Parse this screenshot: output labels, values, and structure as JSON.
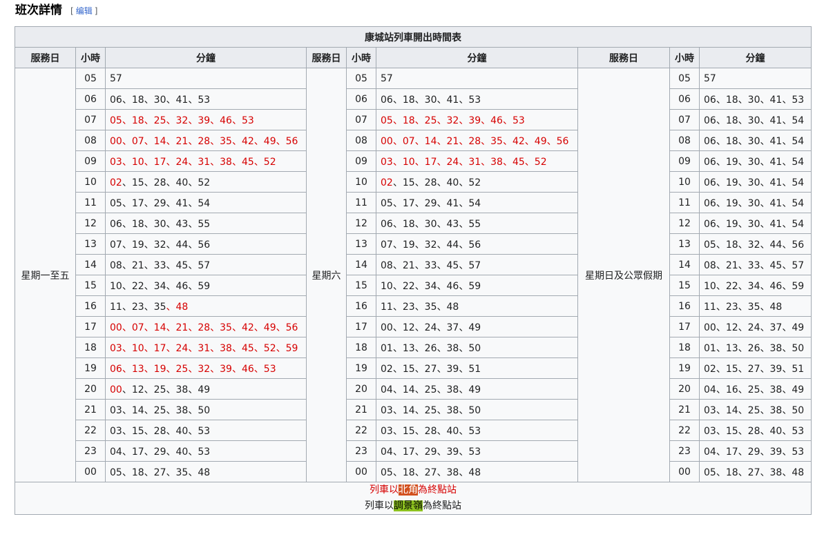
{
  "section": {
    "title": "班次詳情",
    "edit": "编辑",
    "bl": "[",
    "br": "]"
  },
  "table": {
    "caption": "康城站列車開出時間表",
    "headers": {
      "day": "服務日",
      "hour": "小時",
      "min": "分鐘"
    },
    "days": [
      "星期一至五",
      "星期六",
      "星期日及公眾假期"
    ],
    "hours": [
      "05",
      "06",
      "07",
      "08",
      "09",
      "10",
      "11",
      "12",
      "13",
      "14",
      "15",
      "16",
      "17",
      "18",
      "19",
      "20",
      "21",
      "22",
      "23",
      "00"
    ],
    "sep": "、",
    "weekday": [
      [
        {
          "v": "57"
        }
      ],
      [
        {
          "v": "06"
        },
        {
          "v": "18"
        },
        {
          "v": "30"
        },
        {
          "v": "41"
        },
        {
          "v": "53"
        }
      ],
      [
        {
          "v": "05",
          "r": 1
        },
        {
          "v": "18",
          "r": 1
        },
        {
          "v": "25",
          "r": 1
        },
        {
          "v": "32",
          "r": 1
        },
        {
          "v": "39",
          "r": 1
        },
        {
          "v": "46",
          "r": 1
        },
        {
          "v": "53",
          "r": 1
        }
      ],
      [
        {
          "v": "00",
          "r": 1
        },
        {
          "v": "07",
          "r": 1
        },
        {
          "v": "14",
          "r": 1
        },
        {
          "v": "21",
          "r": 1
        },
        {
          "v": "28",
          "r": 1
        },
        {
          "v": "35",
          "r": 1
        },
        {
          "v": "42",
          "r": 1
        },
        {
          "v": "49",
          "r": 1
        },
        {
          "v": "56",
          "r": 1
        }
      ],
      [
        {
          "v": "03",
          "r": 1
        },
        {
          "v": "10",
          "r": 1
        },
        {
          "v": "17",
          "r": 1
        },
        {
          "v": "24",
          "r": 1
        },
        {
          "v": "31",
          "r": 1
        },
        {
          "v": "38",
          "r": 1
        },
        {
          "v": "45",
          "r": 1
        },
        {
          "v": "52",
          "r": 1
        }
      ],
      [
        {
          "v": "02",
          "r": 1
        },
        {
          "v": "15"
        },
        {
          "v": "28"
        },
        {
          "v": "40"
        },
        {
          "v": "52"
        }
      ],
      [
        {
          "v": "05"
        },
        {
          "v": "17"
        },
        {
          "v": "29"
        },
        {
          "v": "41"
        },
        {
          "v": "54"
        }
      ],
      [
        {
          "v": "06"
        },
        {
          "v": "18"
        },
        {
          "v": "30"
        },
        {
          "v": "43"
        },
        {
          "v": "55"
        }
      ],
      [
        {
          "v": "07"
        },
        {
          "v": "19"
        },
        {
          "v": "32"
        },
        {
          "v": "44"
        },
        {
          "v": "56"
        }
      ],
      [
        {
          "v": "08"
        },
        {
          "v": "21"
        },
        {
          "v": "33"
        },
        {
          "v": "45"
        },
        {
          "v": "57"
        }
      ],
      [
        {
          "v": "10"
        },
        {
          "v": "22"
        },
        {
          "v": "34"
        },
        {
          "v": "46"
        },
        {
          "v": "59"
        }
      ],
      [
        {
          "v": "11"
        },
        {
          "v": "23"
        },
        {
          "v": "35"
        },
        {
          "v": "48",
          "r": 1
        }
      ],
      [
        {
          "v": "00",
          "r": 1
        },
        {
          "v": "07",
          "r": 1
        },
        {
          "v": "14",
          "r": 1
        },
        {
          "v": "21",
          "r": 1
        },
        {
          "v": "28",
          "r": 1
        },
        {
          "v": "35",
          "r": 1
        },
        {
          "v": "42",
          "r": 1
        },
        {
          "v": "49",
          "r": 1
        },
        {
          "v": "56",
          "r": 1
        }
      ],
      [
        {
          "v": "03",
          "r": 1
        },
        {
          "v": "10",
          "r": 1
        },
        {
          "v": "17",
          "r": 1
        },
        {
          "v": "24",
          "r": 1
        },
        {
          "v": "31",
          "r": 1
        },
        {
          "v": "38",
          "r": 1
        },
        {
          "v": "45",
          "r": 1
        },
        {
          "v": "52",
          "r": 1
        },
        {
          "v": "59",
          "r": 1
        }
      ],
      [
        {
          "v": "06",
          "r": 1
        },
        {
          "v": "13",
          "r": 1
        },
        {
          "v": "19",
          "r": 1
        },
        {
          "v": "25",
          "r": 1
        },
        {
          "v": "32",
          "r": 1
        },
        {
          "v": "39",
          "r": 1
        },
        {
          "v": "46",
          "r": 1
        },
        {
          "v": "53",
          "r": 1
        }
      ],
      [
        {
          "v": "00",
          "r": 1
        },
        {
          "v": "12"
        },
        {
          "v": "25"
        },
        {
          "v": "38"
        },
        {
          "v": "49"
        }
      ],
      [
        {
          "v": "03"
        },
        {
          "v": "14"
        },
        {
          "v": "25"
        },
        {
          "v": "38"
        },
        {
          "v": "50"
        }
      ],
      [
        {
          "v": "03"
        },
        {
          "v": "15"
        },
        {
          "v": "28"
        },
        {
          "v": "40"
        },
        {
          "v": "53"
        }
      ],
      [
        {
          "v": "04"
        },
        {
          "v": "17"
        },
        {
          "v": "29"
        },
        {
          "v": "40"
        },
        {
          "v": "53"
        }
      ],
      [
        {
          "v": "05"
        },
        {
          "v": "18"
        },
        {
          "v": "27"
        },
        {
          "v": "35"
        },
        {
          "v": "48"
        }
      ]
    ],
    "saturday": [
      [
        {
          "v": "57"
        }
      ],
      [
        {
          "v": "06"
        },
        {
          "v": "18"
        },
        {
          "v": "30"
        },
        {
          "v": "41"
        },
        {
          "v": "53"
        }
      ],
      [
        {
          "v": "05",
          "r": 1
        },
        {
          "v": "18",
          "r": 1
        },
        {
          "v": "25",
          "r": 1
        },
        {
          "v": "32",
          "r": 1
        },
        {
          "v": "39",
          "r": 1
        },
        {
          "v": "46",
          "r": 1
        },
        {
          "v": "53",
          "r": 1
        }
      ],
      [
        {
          "v": "00",
          "r": 1
        },
        {
          "v": "07",
          "r": 1
        },
        {
          "v": "14",
          "r": 1
        },
        {
          "v": "21",
          "r": 1
        },
        {
          "v": "28",
          "r": 1
        },
        {
          "v": "35",
          "r": 1
        },
        {
          "v": "42",
          "r": 1
        },
        {
          "v": "49",
          "r": 1
        },
        {
          "v": "56",
          "r": 1
        }
      ],
      [
        {
          "v": "03",
          "r": 1
        },
        {
          "v": "10",
          "r": 1
        },
        {
          "v": "17",
          "r": 1
        },
        {
          "v": "24",
          "r": 1
        },
        {
          "v": "31",
          "r": 1
        },
        {
          "v": "38",
          "r": 1
        },
        {
          "v": "45",
          "r": 1
        },
        {
          "v": "52",
          "r": 1
        }
      ],
      [
        {
          "v": "02",
          "r": 1
        },
        {
          "v": "15"
        },
        {
          "v": "28"
        },
        {
          "v": "40"
        },
        {
          "v": "52"
        }
      ],
      [
        {
          "v": "05"
        },
        {
          "v": "17"
        },
        {
          "v": "29"
        },
        {
          "v": "41"
        },
        {
          "v": "54"
        }
      ],
      [
        {
          "v": "06"
        },
        {
          "v": "18"
        },
        {
          "v": "30"
        },
        {
          "v": "43"
        },
        {
          "v": "55"
        }
      ],
      [
        {
          "v": "07"
        },
        {
          "v": "19"
        },
        {
          "v": "32"
        },
        {
          "v": "44"
        },
        {
          "v": "56"
        }
      ],
      [
        {
          "v": "08"
        },
        {
          "v": "21"
        },
        {
          "v": "33"
        },
        {
          "v": "45"
        },
        {
          "v": "57"
        }
      ],
      [
        {
          "v": "10"
        },
        {
          "v": "22"
        },
        {
          "v": "34"
        },
        {
          "v": "46"
        },
        {
          "v": "59"
        }
      ],
      [
        {
          "v": "11"
        },
        {
          "v": "23"
        },
        {
          "v": "35"
        },
        {
          "v": "48"
        }
      ],
      [
        {
          "v": "00"
        },
        {
          "v": "12"
        },
        {
          "v": "24"
        },
        {
          "v": "37"
        },
        {
          "v": "49"
        }
      ],
      [
        {
          "v": "01"
        },
        {
          "v": "13"
        },
        {
          "v": "26"
        },
        {
          "v": "38"
        },
        {
          "v": "50"
        }
      ],
      [
        {
          "v": "02"
        },
        {
          "v": "15"
        },
        {
          "v": "27"
        },
        {
          "v": "39"
        },
        {
          "v": "51"
        }
      ],
      [
        {
          "v": "04"
        },
        {
          "v": "14"
        },
        {
          "v": "25"
        },
        {
          "v": "38"
        },
        {
          "v": "49"
        }
      ],
      [
        {
          "v": "03"
        },
        {
          "v": "14"
        },
        {
          "v": "25"
        },
        {
          "v": "38"
        },
        {
          "v": "50"
        }
      ],
      [
        {
          "v": "03"
        },
        {
          "v": "15"
        },
        {
          "v": "28"
        },
        {
          "v": "40"
        },
        {
          "v": "53"
        }
      ],
      [
        {
          "v": "04"
        },
        {
          "v": "17"
        },
        {
          "v": "29"
        },
        {
          "v": "39"
        },
        {
          "v": "53"
        }
      ],
      [
        {
          "v": "05"
        },
        {
          "v": "18"
        },
        {
          "v": "27"
        },
        {
          "v": "38"
        },
        {
          "v": "48"
        }
      ]
    ],
    "sunday": [
      [
        {
          "v": "57"
        }
      ],
      [
        {
          "v": "06"
        },
        {
          "v": "18"
        },
        {
          "v": "30"
        },
        {
          "v": "41"
        },
        {
          "v": "53"
        }
      ],
      [
        {
          "v": "06"
        },
        {
          "v": "18"
        },
        {
          "v": "30"
        },
        {
          "v": "41"
        },
        {
          "v": "54"
        }
      ],
      [
        {
          "v": "06"
        },
        {
          "v": "18"
        },
        {
          "v": "30"
        },
        {
          "v": "41"
        },
        {
          "v": "54"
        }
      ],
      [
        {
          "v": "06"
        },
        {
          "v": "19"
        },
        {
          "v": "30"
        },
        {
          "v": "41"
        },
        {
          "v": "54"
        }
      ],
      [
        {
          "v": "06"
        },
        {
          "v": "19"
        },
        {
          "v": "30"
        },
        {
          "v": "41"
        },
        {
          "v": "54"
        }
      ],
      [
        {
          "v": "06"
        },
        {
          "v": "19"
        },
        {
          "v": "30"
        },
        {
          "v": "41"
        },
        {
          "v": "54"
        }
      ],
      [
        {
          "v": "06"
        },
        {
          "v": "19"
        },
        {
          "v": "30"
        },
        {
          "v": "41"
        },
        {
          "v": "54"
        }
      ],
      [
        {
          "v": "05"
        },
        {
          "v": "18"
        },
        {
          "v": "32"
        },
        {
          "v": "44"
        },
        {
          "v": "56"
        }
      ],
      [
        {
          "v": "08"
        },
        {
          "v": "21"
        },
        {
          "v": "33"
        },
        {
          "v": "45"
        },
        {
          "v": "57"
        }
      ],
      [
        {
          "v": "10"
        },
        {
          "v": "22"
        },
        {
          "v": "34"
        },
        {
          "v": "46"
        },
        {
          "v": "59"
        }
      ],
      [
        {
          "v": "11"
        },
        {
          "v": "23"
        },
        {
          "v": "35"
        },
        {
          "v": "48"
        }
      ],
      [
        {
          "v": "00"
        },
        {
          "v": "12"
        },
        {
          "v": "24"
        },
        {
          "v": "37"
        },
        {
          "v": "49"
        }
      ],
      [
        {
          "v": "01"
        },
        {
          "v": "13"
        },
        {
          "v": "26"
        },
        {
          "v": "38"
        },
        {
          "v": "50"
        }
      ],
      [
        {
          "v": "02"
        },
        {
          "v": "15"
        },
        {
          "v": "27"
        },
        {
          "v": "39"
        },
        {
          "v": "51"
        }
      ],
      [
        {
          "v": "04"
        },
        {
          "v": "16"
        },
        {
          "v": "25"
        },
        {
          "v": "38"
        },
        {
          "v": "49"
        }
      ],
      [
        {
          "v": "03"
        },
        {
          "v": "14"
        },
        {
          "v": "25"
        },
        {
          "v": "38"
        },
        {
          "v": "50"
        }
      ],
      [
        {
          "v": "03"
        },
        {
          "v": "15"
        },
        {
          "v": "28"
        },
        {
          "v": "40"
        },
        {
          "v": "53"
        }
      ],
      [
        {
          "v": "04"
        },
        {
          "v": "17"
        },
        {
          "v": "29"
        },
        {
          "v": "39"
        },
        {
          "v": "53"
        }
      ],
      [
        {
          "v": "05"
        },
        {
          "v": "18"
        },
        {
          "v": "27"
        },
        {
          "v": "38"
        },
        {
          "v": "48"
        }
      ]
    ]
  },
  "legend": {
    "line1": {
      "pre": "列車以",
      "station": "北角",
      "post": "為終點站"
    },
    "line2": {
      "pre": "列車以",
      "station": "調景嶺",
      "post": "為終點站"
    }
  },
  "colors": {
    "red_text": "#d60000",
    "north_point": "#d2501e",
    "tiu_keng_leng": "#8dc21f"
  }
}
